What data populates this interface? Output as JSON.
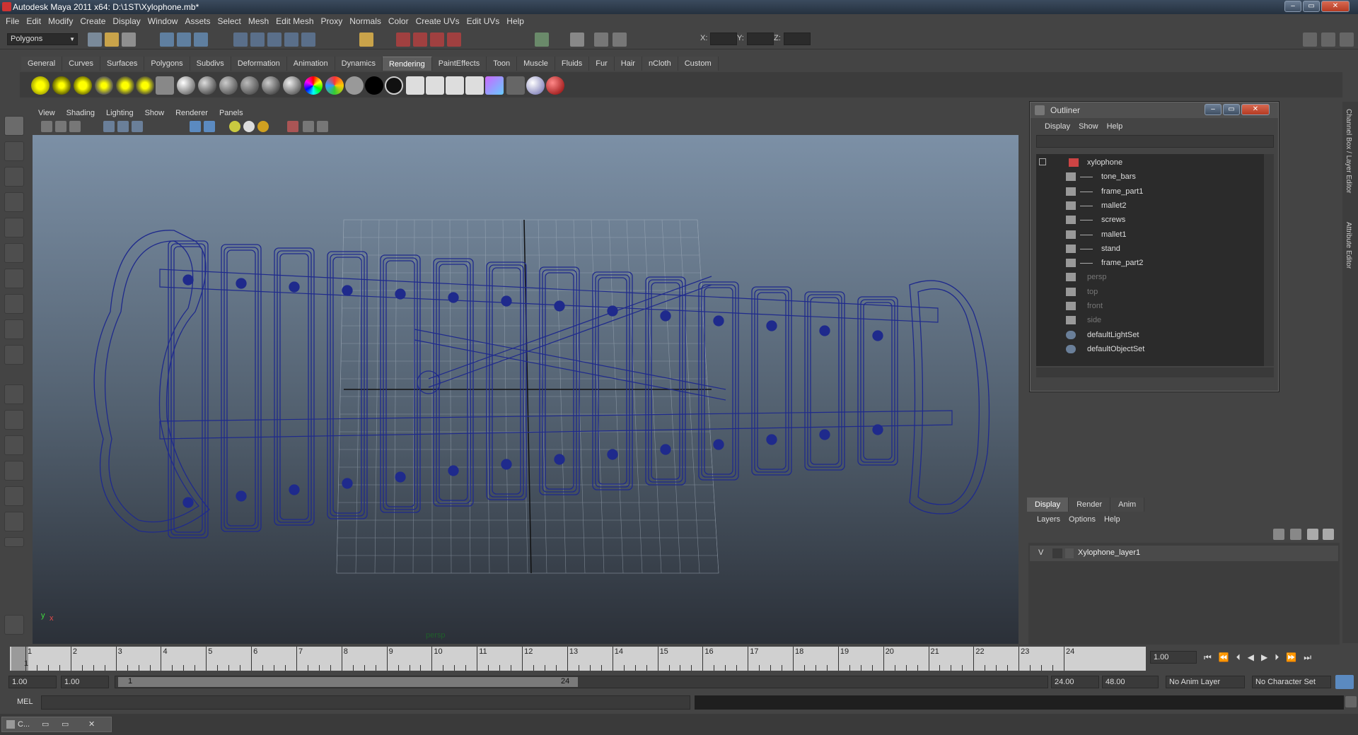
{
  "window": {
    "title": "Autodesk Maya 2011 x64: D:\\1ST\\Xylophone.mb*",
    "min": "‒",
    "max": "▭",
    "close": "✕"
  },
  "menubar": [
    "File",
    "Edit",
    "Modify",
    "Create",
    "Display",
    "Window",
    "Assets",
    "Select",
    "Mesh",
    "Edit Mesh",
    "Proxy",
    "Normals",
    "Color",
    "Create UVs",
    "Edit UVs",
    "Help"
  ],
  "status": {
    "mode": "Polygons",
    "x_label": "X:",
    "y_label": "Y:",
    "z_label": "Z:"
  },
  "shelf_tabs": [
    "General",
    "Curves",
    "Surfaces",
    "Polygons",
    "Subdivs",
    "Deformation",
    "Animation",
    "Dynamics",
    "Rendering",
    "PaintEffects",
    "Toon",
    "Muscle",
    "Fluids",
    "Fur",
    "Hair",
    "nCloth",
    "Custom"
  ],
  "shelf_active": "Rendering",
  "viewport": {
    "menu": [
      "View",
      "Shading",
      "Lighting",
      "Show",
      "Renderer",
      "Panels"
    ],
    "camera_label": "persp",
    "axis_y": "y",
    "axis_x": "x"
  },
  "outliner": {
    "title": "Outliner",
    "menu": [
      "Display",
      "Show",
      "Help"
    ],
    "items": [
      {
        "label": "xylophone",
        "dim": false
      },
      {
        "label": "tone_bars",
        "dim": false
      },
      {
        "label": "frame_part1",
        "dim": false
      },
      {
        "label": "mallet2",
        "dim": false
      },
      {
        "label": "screws",
        "dim": false
      },
      {
        "label": "mallet1",
        "dim": false
      },
      {
        "label": "stand",
        "dim": false
      },
      {
        "label": "frame_part2",
        "dim": false
      },
      {
        "label": "persp",
        "dim": true
      },
      {
        "label": "top",
        "dim": true
      },
      {
        "label": "front",
        "dim": true
      },
      {
        "label": "side",
        "dim": true
      },
      {
        "label": "defaultLightSet",
        "dim": false
      },
      {
        "label": "defaultObjectSet",
        "dim": false
      }
    ]
  },
  "side_tabs": {
    "channel_box": "Channel Box / Layer Editor",
    "attribute_editor": "Attribute Editor"
  },
  "layer_editor": {
    "tabs": [
      "Display",
      "Render",
      "Anim"
    ],
    "menu": [
      "Layers",
      "Options",
      "Help"
    ],
    "layer": {
      "visible": "V",
      "name": "Xylophone_layer1"
    }
  },
  "timeline": {
    "ticks": [
      "1",
      "2",
      "3",
      "4",
      "5",
      "6",
      "7",
      "8",
      "9",
      "10",
      "11",
      "12",
      "13",
      "14",
      "15",
      "16",
      "17",
      "18",
      "19",
      "20",
      "21",
      "22",
      "23",
      "24"
    ],
    "current": "1",
    "current_field": "1.00"
  },
  "range": {
    "start": "1.00",
    "anim_start": "1.00",
    "slider_start": "1",
    "slider_end": "24",
    "end": "24.00",
    "anim_end": "48.00",
    "anim_layer": "No Anim Layer",
    "char_set": "No Character Set"
  },
  "command": {
    "label": "MEL"
  },
  "taskbar": {
    "label": "C..."
  }
}
